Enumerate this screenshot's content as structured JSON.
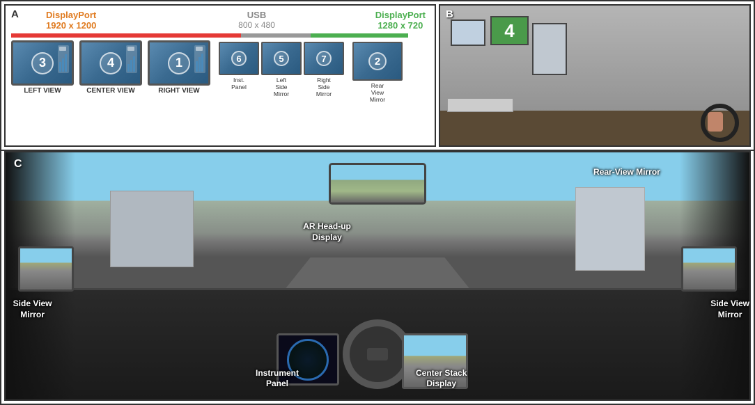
{
  "panels": {
    "a_label": "A",
    "b_label": "B",
    "c_label": "C"
  },
  "display_port_left": {
    "name": "DisplayPort",
    "resolution": "1920 x 1200"
  },
  "usb": {
    "name": "USB",
    "resolution": "800 x 480"
  },
  "display_port_right": {
    "name": "DisplayPort",
    "resolution": "1280 x 720"
  },
  "monitors": [
    {
      "number": "3",
      "label": "LEFT VIEW"
    },
    {
      "number": "4",
      "label": "CENTER VIEW"
    },
    {
      "number": "1",
      "label": "RIGHT VIEW"
    }
  ],
  "small_monitors": [
    {
      "number": "6",
      "label": "Inst.\nPanel"
    },
    {
      "number": "5",
      "label": "Left\nSide\nMirror"
    },
    {
      "number": "7",
      "label": "Right\nSide\nMirror"
    }
  ],
  "rear_monitor": {
    "number": "2",
    "label": "Rear\nView\nMirror"
  },
  "panel_c_labels": {
    "ar_hud": "AR Head-up\nDisplay",
    "rear_mirror": "Rear-View Mirror",
    "side_mirror_left": "Side View\nMirror",
    "side_mirror_right": "Side View\nMirror",
    "instrument": "Instrument\nPanel",
    "center_stack": "Center Stack\nDisplay"
  }
}
